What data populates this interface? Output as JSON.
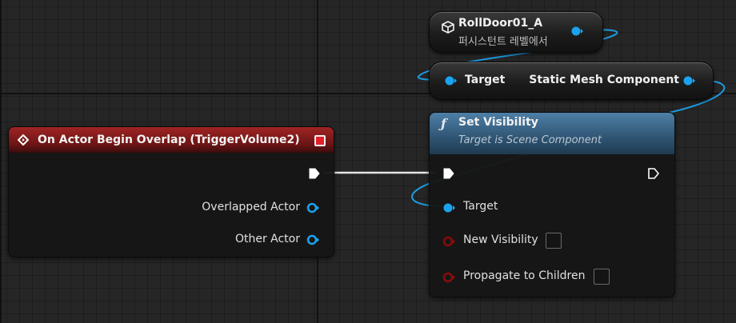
{
  "event_node": {
    "title": "On Actor Begin Overlap (TriggerVolume2)",
    "pins": {
      "overlapped_actor": "Overlapped Actor",
      "other_actor": "Other Actor"
    }
  },
  "actor_ref_node": {
    "title": "RollDoor01_A",
    "subtitle": "퍼시스턴트 레벨에서"
  },
  "getter_node": {
    "input_label": "Target",
    "output_label": "Static Mesh Component"
  },
  "function_node": {
    "icon_glyph": "ƒ",
    "title": "Set Visibility",
    "subtitle": "Target is Scene Component",
    "pins": {
      "target": "Target",
      "new_visibility": "New Visibility",
      "propagate": "Propagate to Children"
    },
    "values": {
      "new_visibility": false,
      "propagate": false
    }
  },
  "colors": {
    "event_header": "#8b1c1c",
    "function_header": "#3a6688",
    "object_pin": "#1aa3f0",
    "bool_pin": "#8a0b0b",
    "exec_pin": "#ffffff",
    "event_close_square": "#e3202a"
  }
}
